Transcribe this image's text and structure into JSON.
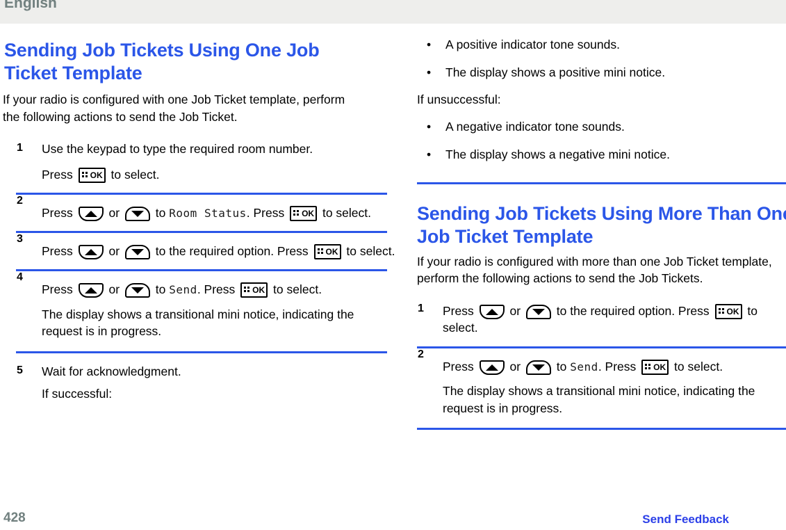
{
  "header": {
    "language_label": "English"
  },
  "colors": {
    "heading_blue": "#2b56e8",
    "rule_blue": "#2b56e8",
    "footer_gray": "#71807f",
    "link_blue": "#2b3fe8",
    "header_bg": "#eeeeec"
  },
  "left_column": {
    "heading": "Sending Job Tickets Using One Job Ticket Template",
    "intro": "If your radio is configured with one Job Ticket template, perform the following actions to send the Job Ticket.",
    "steps": [
      {
        "number": "1",
        "line1": "Use the keypad to type the required room number.",
        "line2_before": "Press",
        "line2_after": "to select."
      },
      {
        "number": "2",
        "press_label": "Press",
        "or_label": "or",
        "to_label": "to",
        "target": "Room Status",
        "press2_label": ". Press",
        "tail": "to select."
      },
      {
        "number": "3",
        "press_label": "Press",
        "or_label": "or",
        "to_label": "to the required option. Press",
        "tail": "to select."
      },
      {
        "number": "4",
        "press_label": "Press",
        "or_label": "or",
        "to_label": "to",
        "target": "Send",
        "press2_label": ". Press",
        "tail": "to select.",
        "note": "The display shows a transitional mini notice, indicating the request is in progress."
      },
      {
        "number": "5",
        "line1": "Wait for acknowledgment.",
        "line2": "If successful:"
      }
    ]
  },
  "right_column": {
    "success_bullets": [
      "A positive indicator tone sounds.",
      "The display shows a positive mini notice."
    ],
    "unsuccessful_label": "If unsuccessful:",
    "failure_bullets": [
      "A negative indicator tone sounds.",
      "The display shows a negative mini notice."
    ],
    "heading": "Sending Job Tickets Using More Than One Job Ticket Template",
    "intro": "If your radio is configured with more than one Job Ticket template, perform the following actions to send the Job Tickets.",
    "steps": [
      {
        "number": "1",
        "press_label": "Press",
        "or_label": "or",
        "to_label": "to the required option. Press",
        "tail": "to select."
      },
      {
        "number": "2",
        "press_label": "Press",
        "or_label": "or",
        "to_label": "to",
        "target": "Send",
        "press2_label": ". Press",
        "tail": "to select.",
        "note": "The display shows a transitional mini notice, indicating the request is in progress."
      }
    ]
  },
  "icons": {
    "ok_key_label": "OK",
    "ok_key_name": "menu-ok-key-icon",
    "up_key_name": "navigate-up-key-icon",
    "down_key_name": "navigate-down-key-icon",
    "bullet_glyph": "•"
  },
  "footer": {
    "page_number": "428",
    "send_feedback": "Send Feedback"
  }
}
